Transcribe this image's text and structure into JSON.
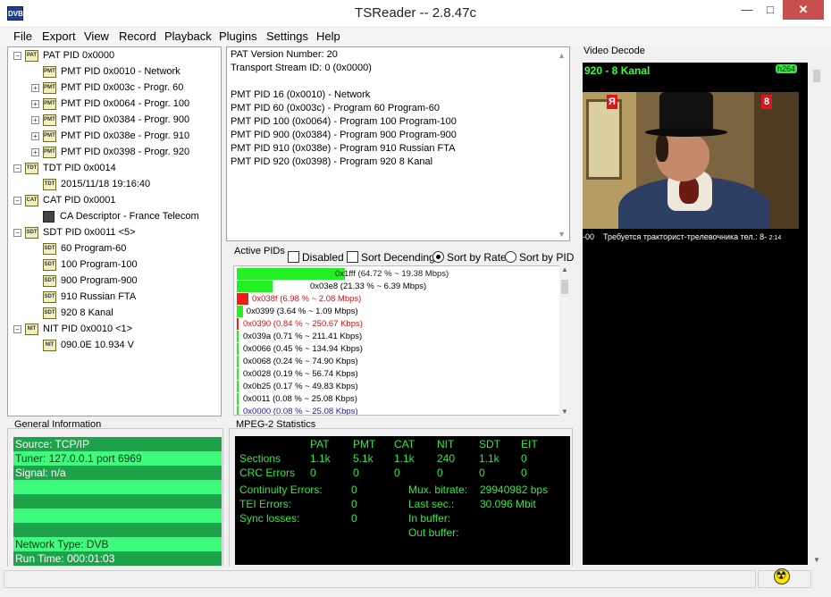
{
  "window": {
    "title": "TSReader -- 2.8.47c",
    "icon_text": "DVB",
    "min_glyph": "—",
    "max_glyph": "□",
    "close_glyph": "✕"
  },
  "menu": [
    "File",
    "Export",
    "View",
    "Record",
    "Playback",
    "Plugins",
    "Settings",
    "Help"
  ],
  "tree": [
    {
      "badge": "PAT",
      "label": "PAT PID 0x0000",
      "expander": "−",
      "level": 0
    },
    {
      "badge": "PMT",
      "label": "PMT PID 0x0010 - Network",
      "expander": "",
      "level": 1
    },
    {
      "badge": "PMT",
      "label": "PMT PID 0x003c - Progr. 60",
      "expander": "+",
      "level": 1
    },
    {
      "badge": "PMT",
      "label": "PMT PID 0x0064 - Progr. 100",
      "expander": "+",
      "level": 1
    },
    {
      "badge": "PMT",
      "label": "PMT PID 0x0384 - Progr. 900",
      "expander": "+",
      "level": 1
    },
    {
      "badge": "PMT",
      "label": "PMT PID 0x038e - Progr. 910",
      "expander": "+",
      "level": 1
    },
    {
      "badge": "PMT",
      "label": "PMT PID 0x0398 - Progr. 920",
      "expander": "+",
      "level": 1
    },
    {
      "badge": "TDT",
      "label": "TDT PID 0x0014",
      "expander": "−",
      "level": 0
    },
    {
      "badge": "TDT",
      "label": "2015/11/18 19:16:40",
      "expander": "",
      "level": 1
    },
    {
      "badge": "CAT",
      "label": "CAT PID 0x0001",
      "expander": "−",
      "level": 0
    },
    {
      "badge": "",
      "label": "CA Descriptor - France Telecom",
      "expander": "",
      "level": 1
    },
    {
      "badge": "SDT",
      "label": "SDT PID 0x0011 <5>",
      "expander": "−",
      "level": 0
    },
    {
      "badge": "SDT",
      "label": "60 Program-60",
      "expander": "",
      "level": 1
    },
    {
      "badge": "SDT",
      "label": "100 Program-100",
      "expander": "",
      "level": 1
    },
    {
      "badge": "SDT",
      "label": "900 Program-900",
      "expander": "",
      "level": 1
    },
    {
      "badge": "SDT",
      "label": "910 Russian FTA",
      "expander": "",
      "level": 1
    },
    {
      "badge": "SDT",
      "label": "920 8 Kanal",
      "expander": "",
      "level": 1
    },
    {
      "badge": "NIT",
      "label": "NIT PID 0x0010 <1>",
      "expander": "−",
      "level": 0
    },
    {
      "badge": "NIT",
      "label": "090.0E 10.934 V",
      "expander": "",
      "level": 1
    }
  ],
  "pat_info": [
    "PAT Version Number: 20",
    "Transport Stream ID: 0 (0x0000)",
    "",
    "PMT PID 16 (0x0010) - Network",
    "PMT PID 60 (0x003c) - Program 60 Program-60",
    "PMT PID 100 (0x0064) - Program 100 Program-100",
    "PMT PID 900 (0x0384) - Program 900 Program-900",
    "PMT PID 910 (0x038e) - Program 910 Russian FTA",
    "PMT PID 920 (0x0398) - Program 920 8 Kanal"
  ],
  "active_pids": {
    "label": "Active PIDs",
    "options": {
      "disabled": {
        "label": "Disabled",
        "checked": false
      },
      "sort_descending": {
        "label": "Sort Decending",
        "checked": false
      },
      "sort_by_rate": {
        "label": "Sort by Rate",
        "selected": true
      },
      "sort_by_pid": {
        "label": "Sort by PID",
        "selected": false
      }
    },
    "rows": [
      {
        "text": "0x1fff (64.72 % ~ 19.38 Mbps)",
        "percent": 64.72,
        "color": "#22f022",
        "text_color": "#1a1a1a"
      },
      {
        "text": "0x03e8 (21.33 % ~ 6.39 Mbps)",
        "percent": 21.33,
        "color": "#22f022",
        "text_color": "#000000"
      },
      {
        "text": "0x038f (6.98 % ~ 2.08 Mbps)",
        "percent": 6.98,
        "color": "#ee1c1c",
        "text_color": "#d01010"
      },
      {
        "text": "0x0399 (3.64 % ~ 1.09 Mbps)",
        "percent": 3.64,
        "color": "#22f022",
        "text_color": "#000000"
      },
      {
        "text": "0x0390 (0.84 % ~ 250.67 Kbps)",
        "percent": 0.84,
        "color": "#ee1c1c",
        "text_color": "#d01010"
      },
      {
        "text": "0x039a (0.71 % ~ 211.41 Kbps)",
        "percent": 0.71,
        "color": "#22f022",
        "text_color": "#000000"
      },
      {
        "text": "0x0066 (0.45 % ~ 134.94 Kbps)",
        "percent": 0.45,
        "color": "#22f022",
        "text_color": "#000000"
      },
      {
        "text": "0x0068 (0.24 % ~ 74.90 Kbps)",
        "percent": 0.24,
        "color": "#22f022",
        "text_color": "#000000"
      },
      {
        "text": "0x0028 (0.19 % ~ 56.74 Kbps)",
        "percent": 0.19,
        "color": "#22f022",
        "text_color": "#000000"
      },
      {
        "text": "0x0b25 (0.17 % ~ 49.83 Kbps)",
        "percent": 0.17,
        "color": "#22f022",
        "text_color": "#000000"
      },
      {
        "text": "0x0011 (0.08 % ~ 25.08 Kbps)",
        "percent": 0.08,
        "color": "#22f022",
        "text_color": "#000000"
      },
      {
        "text": "0x0000 (0.08 % ~ 25.08 Kbps)",
        "percent": 0.08,
        "color": "#22f022",
        "text_color": "#1a1ab4"
      }
    ]
  },
  "general_info": {
    "label": "General Information",
    "rows": [
      "Source: TCP/IP",
      "Tuner: 127.0.0.1 port 6969",
      "Signal: n/a",
      "",
      "",
      "",
      "",
      "Network Type: DVB",
      "Run Time: 000:01:03"
    ]
  },
  "mpeg2_stats": {
    "label": "MPEG-2 Statistics",
    "headers": [
      "PAT",
      "PMT",
      "CAT",
      "NIT",
      "SDT",
      "EIT"
    ],
    "sections_label": "Sections",
    "sections": [
      "1.1k",
      "5.1k",
      "1.1k",
      "240",
      "1.1k",
      "0"
    ],
    "crc_label": "CRC Errors",
    "crc": [
      "0",
      "0",
      "0",
      "0",
      "0",
      "0"
    ],
    "continuity_label": "Continuity Errors:",
    "continuity_value": "0",
    "tei_label": "TEI Errors:",
    "tei_value": "0",
    "sync_label": "Sync losses:",
    "sync_value": "0",
    "mux_label": "Mux. bitrate:",
    "mux_value": "29940982 bps",
    "last_sec_label": "Last sec.:",
    "last_sec_value": "30.096 Mbit",
    "in_buffer_label": "In buffer:",
    "out_buffer_label": "Out buffer:"
  },
  "video_decode": {
    "label": "Video Decode",
    "channel": "920 - 8 Kanal",
    "codec": "h264",
    "logo_left": "Я",
    "logo_right": "8",
    "ticker_prefix": "-00",
    "ticker_text": "Требуется тракторист-трелевочника тел.: 8-",
    "ticker_time": "2:14"
  }
}
